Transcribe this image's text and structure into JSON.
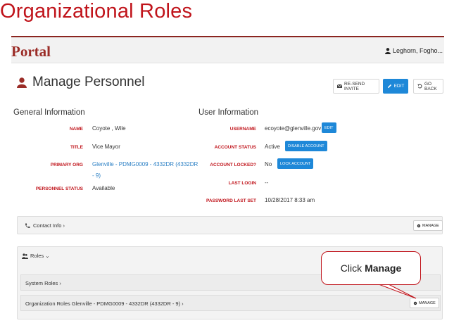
{
  "slide": {
    "title": "Organizational Roles"
  },
  "app": {
    "brand": "Portal",
    "user_name": "Leghorn, Fogho..."
  },
  "page": {
    "title": "Manage Personnel"
  },
  "actions": {
    "resend_invite": "Re-send Invite",
    "edit": "Edit",
    "go_back": "Go Back"
  },
  "general": {
    "heading": "General Information",
    "name_label": "Name",
    "name_value": "Coyote , Wile",
    "title_label": "Title",
    "title_value": "Vice Mayor",
    "org_label": "Primary Org",
    "org_value_line1": "Glenville - PDMG0009 - 4332DR (4332DR",
    "org_value_line2": "- 9)",
    "status_label": "Personnel Status",
    "status_value": "Available"
  },
  "user": {
    "heading": "User Information",
    "username_label": "Username",
    "username_value": "ecoyote@glenville.gov",
    "username_edit": "Edit",
    "account_status_label": "Account Status",
    "account_status_value": "Active",
    "disable_account": "Disable Account",
    "locked_label": "Account Locked?",
    "locked_value": "No",
    "lock_account": "Lock Account",
    "last_login_label": "Last Login",
    "last_login_value": "--",
    "password_label": "Password Last Set",
    "password_value": "10/28/2017 8:33 am"
  },
  "contact": {
    "label": "Contact Info ›",
    "manage": "Manage"
  },
  "roles": {
    "label": "Roles ⌄",
    "system_roles": "System Roles ›",
    "org_roles": "Organization Roles Glenville - PDMG0009 - 4332DR (4332DR - 9) ›",
    "manage": "Manage"
  },
  "callout": {
    "prefix": "Click",
    "action": "Manage"
  },
  "colors": {
    "accent_red": "#c0141b",
    "brand": "#9b2d28",
    "primary_blue": "#1e88d8"
  }
}
